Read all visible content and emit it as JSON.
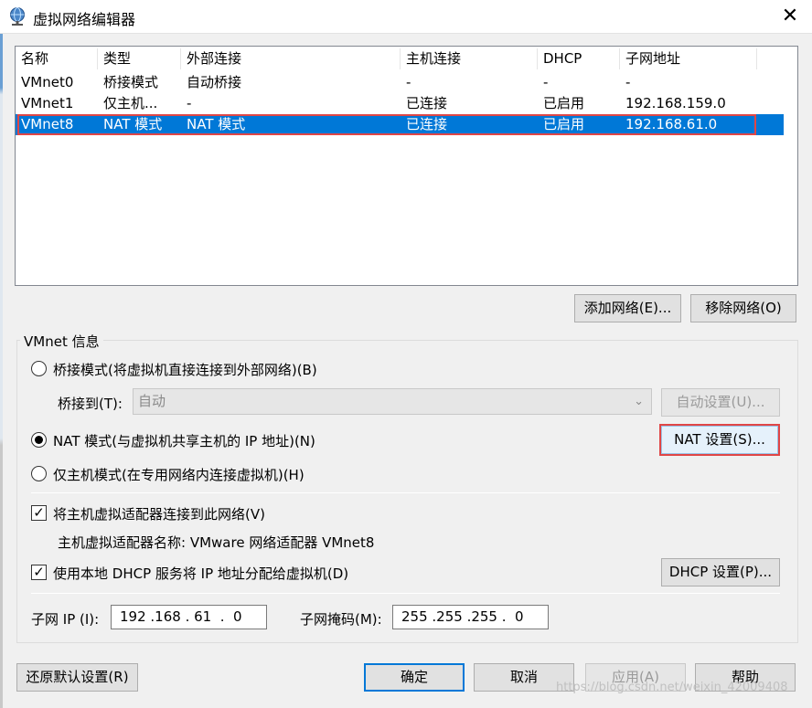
{
  "window": {
    "title": "虚拟网络编辑器",
    "close_icon": "✕"
  },
  "list": {
    "columns": [
      "名称",
      "类型",
      "外部连接",
      "主机连接",
      "DHCP",
      "子网地址"
    ],
    "rows": [
      [
        "VMnet0",
        "桥接模式",
        "自动桥接",
        "-",
        "-",
        "-"
      ],
      [
        "VMnet1",
        "仅主机...",
        "-",
        "已连接",
        "已启用",
        "192.168.159.0"
      ],
      [
        "VMnet8",
        "NAT 模式",
        "NAT 模式",
        "已连接",
        "已启用",
        "192.168.61.0"
      ]
    ],
    "selected_index": 2
  },
  "list_buttons": {
    "add": "添加网络(E)...",
    "remove": "移除网络(O)"
  },
  "group": {
    "title": "VMnet 信息",
    "bridge_mode": "桥接模式(将虚拟机直接连接到外部网络)(B)",
    "bridge_to_label": "桥接到(T):",
    "bridge_to_value": "自动",
    "auto_settings": "自动设置(U)...",
    "nat_mode": "NAT 模式(与虚拟机共享主机的 IP 地址)(N)",
    "nat_settings": "NAT 设置(S)...",
    "host_only": "仅主机模式(在专用网络内连接虚拟机)(H)",
    "selected_mode": "nat",
    "connect_adapter": "将主机虚拟适配器连接到此网络(V)",
    "connect_adapter_checked": true,
    "adapter_name": "主机虚拟适配器名称: VMware 网络适配器 VMnet8",
    "use_dhcp": "使用本地 DHCP 服务将 IP 地址分配给虚拟机(D)",
    "use_dhcp_checked": true,
    "dhcp_settings": "DHCP 设置(P)...",
    "subnet_ip_label": "子网 IP (I):",
    "subnet_ip": "192 .168 . 61  .  0",
    "subnet_mask_label": "子网掩码(M):",
    "subnet_mask": "255 .255 .255 .  0"
  },
  "footer": {
    "restore": "还原默认设置(R)",
    "ok": "确定",
    "cancel": "取消",
    "apply": "应用(A)",
    "help": "帮助"
  },
  "watermark": "https://blog.csdn.net/weixin_42009408",
  "colors": {
    "selection": "#0078d7",
    "highlight_outline": "#e04646"
  }
}
